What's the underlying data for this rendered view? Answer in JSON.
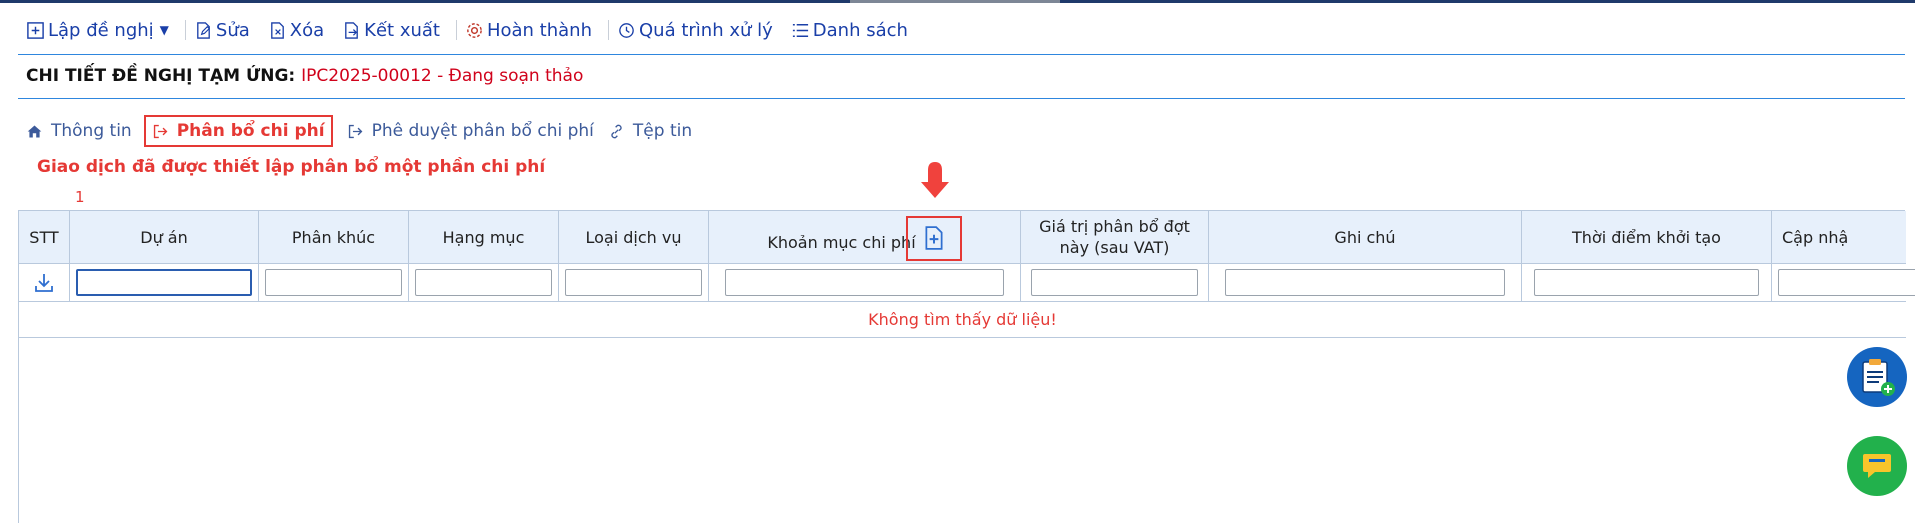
{
  "toolbar": {
    "create_label": "Lập đề nghị",
    "edit_label": "Sửa",
    "delete_label": "Xóa",
    "export_label": "Kết xuất",
    "complete_label": "Hoàn thành",
    "history_label": "Quá trình xử lý",
    "list_label": "Danh sách"
  },
  "header": {
    "title_label": "CHI TIẾT ĐỀ NGHỊ TẠM ỨNG:",
    "title_code": "IPC2025-00012 - Đang soạn thảo"
  },
  "tabs": [
    {
      "label": "Thông tin",
      "icon": "home-icon"
    },
    {
      "label": "Phân bổ chi phí",
      "icon": "sign-out-icon",
      "active": true
    },
    {
      "label": "Phê duyệt phân bổ chi phí",
      "icon": "sign-out-icon"
    },
    {
      "label": "Tệp tin",
      "icon": "link-icon"
    }
  ],
  "notice": "Giao dịch đã được thiết lập phân bổ một phần chi phí",
  "record_count": "1",
  "table": {
    "columns": [
      {
        "label": "STT"
      },
      {
        "label": "Dự án"
      },
      {
        "label": "Phân khúc"
      },
      {
        "label": "Hạng mục"
      },
      {
        "label": "Loại dịch vụ"
      },
      {
        "label": "Khoản mục chi phí"
      },
      {
        "label": "Giá trị phân bổ đợt này (sau VAT)"
      },
      {
        "label": "Ghi chú"
      },
      {
        "label": "Thời điểm khởi tạo"
      },
      {
        "label": "Cập nhậ"
      }
    ],
    "empty_message": "Không tìm thấy dữ liệu!"
  },
  "colors": {
    "accent": "#1a3fa8",
    "error": "#e53935",
    "header_bg": "#e7f0fb",
    "fab_clipboard": "#1565c0",
    "fab_chat": "#22b14c"
  }
}
